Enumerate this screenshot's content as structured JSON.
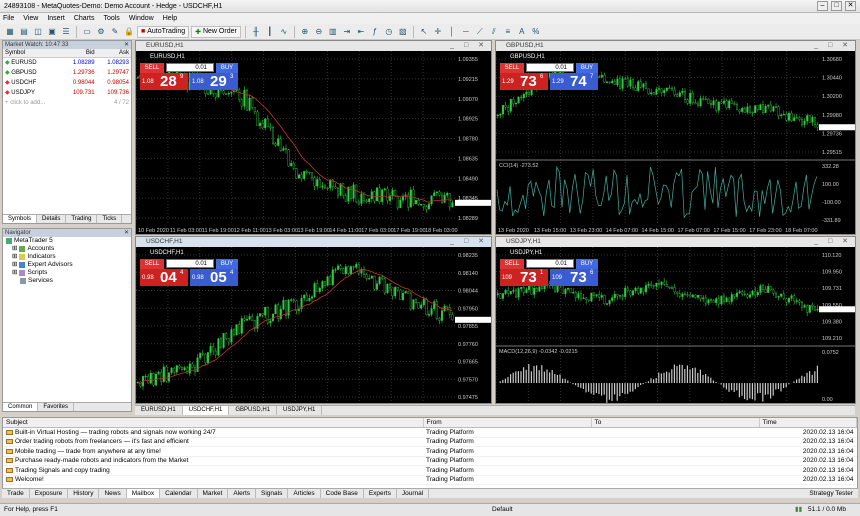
{
  "window": {
    "title": "24893108 - MetaQuotes-Demo: Demo Account - Hedge - USDCHF,H1",
    "min": "–",
    "max": "□",
    "close": "✕"
  },
  "menu": [
    "File",
    "View",
    "Insert",
    "Charts",
    "Tools",
    "Window",
    "Help"
  ],
  "toolbar": {
    "autotrading": "AutoTrading",
    "neworder": "New Order"
  },
  "market_watch": {
    "title": "Market Watch: 10:47:33",
    "cols": [
      "Symbol",
      "Bid",
      "Ask"
    ],
    "rows": [
      [
        "EURUSD",
        "1.08289",
        "1.08293"
      ],
      [
        "GBPUSD",
        "1.29736",
        "1.29747"
      ],
      [
        "USDCHF",
        "0.98044",
        "0.98054"
      ],
      [
        "USDJPY",
        "109.731",
        "109.736"
      ]
    ],
    "add": "click to add...",
    "count": "4 / 72",
    "tabs": [
      "Symbols",
      "Details",
      "Trading",
      "Ticks"
    ]
  },
  "navigator": {
    "title": "Navigator",
    "items": [
      "MetaTrader 5",
      "Accounts",
      "Indicators",
      "Expert Advisors",
      "Scripts",
      "Services"
    ],
    "tabs": [
      "Common",
      "Favorites"
    ]
  },
  "charts": [
    {
      "title": "EURUSD,H1",
      "sym": "EURUSD,H1",
      "lot": "0.01",
      "sell_small": "1.08",
      "sell_big": "28",
      "sell_sup": "9",
      "buy_small": "1.08",
      "buy_big": "29",
      "buy_sup": "3",
      "prices": [
        "1.09355",
        "1.09215",
        "1.09070",
        "1.08925",
        "1.08780",
        "1.08635",
        "1.08490",
        "1.08345",
        "1.08289"
      ],
      "times": [
        "10 Feb 2020",
        "11 Feb 03:00",
        "11 Feb 19:00",
        "12 Feb 11:00",
        "13 Feb 03:00",
        "13 Feb 19:00",
        "14 Feb 11:00",
        "17 Feb 03:00",
        "17 Feb 19:00",
        "18 Feb 03:00"
      ]
    },
    {
      "title": "GBPUSD,H1",
      "sym": "GBPUSD,H1",
      "lot": "0.01",
      "sell_small": "1.29",
      "sell_big": "73",
      "sell_sup": "6",
      "buy_small": "1.29",
      "buy_big": "74",
      "buy_sup": "7",
      "prices": [
        "1.30680",
        "1.30440",
        "1.30200",
        "1.29980",
        "1.29736",
        "1.29515"
      ],
      "ind": "CCI(14) -273.52",
      "ind_vals": [
        "332.28",
        "100.00",
        "-100.00",
        "-331.89"
      ],
      "times": [
        "13 Feb 2020",
        "13 Feb 15:00",
        "13 Feb 23:00",
        "14 Feb 07:00",
        "14 Feb 15:00",
        "17 Feb 07:00",
        "17 Feb 15:00",
        "17 Feb 23:00",
        "18 Feb 07:00"
      ]
    },
    {
      "title": "USDCHF,H1",
      "sym": "USDCHF,H1",
      "lot": "0.01",
      "sell_small": "0.98",
      "sell_big": "04",
      "sell_sup": "4",
      "buy_small": "0.98",
      "buy_big": "05",
      "buy_sup": "4",
      "prices": [
        "0.98235",
        "0.98140",
        "0.98044",
        "0.97950",
        "0.97855",
        "0.97760",
        "0.97665",
        "0.97570",
        "0.97475"
      ]
    },
    {
      "title": "USDJPY,H1",
      "sym": "USDJPY,H1",
      "lot": "0.01",
      "sell_small": "109",
      "sell_big": "73",
      "sell_sup": "1",
      "buy_small": "109",
      "buy_big": "73",
      "buy_sup": "6",
      "prices": [
        "110.120",
        "109.950",
        "109.731",
        "109.550",
        "109.380",
        "109.210"
      ],
      "ind": "MACD(12,26,9) -0.0342 -0.0215",
      "ind_vals": [
        "0.0752",
        "0.00"
      ]
    }
  ],
  "chart_tabs": [
    "EURUSD,H1",
    "USDCHF,H1",
    "GBPUSD,H1",
    "USDJPY,H1"
  ],
  "toolbox": {
    "cols": [
      "Subject",
      "From",
      "To",
      "Time"
    ],
    "rows": [
      [
        "Built-in Virtual Hosting — trading robots and signals now working 24/7",
        "Trading Platform",
        "",
        "2020.02.13 16:04"
      ],
      [
        "Order trading robots from freelancers — it's fast and efficient",
        "Trading Platform",
        "",
        "2020.02.13 16:04"
      ],
      [
        "Mobile trading — trade from anywhere at any time!",
        "Trading Platform",
        "",
        "2020.02.13 16:04"
      ],
      [
        "Purchase ready-made robots and indicators from the Market",
        "Trading Platform",
        "",
        "2020.02.13 16:04"
      ],
      [
        "Trading Signals and copy trading",
        "Trading Platform",
        "",
        "2020.02.13 16:04"
      ],
      [
        "Welcome!",
        "Trading Platform",
        "",
        "2020.02.13 16:04"
      ]
    ],
    "tabs": [
      "Trade",
      "Exposure",
      "History",
      "News",
      "Mailbox",
      "Calendar",
      "Market",
      "Alerts",
      "Signals",
      "Articles",
      "Code Base",
      "Experts",
      "Journal"
    ],
    "strategy": "Strategy Tester",
    "side": "Toolbox"
  },
  "status": {
    "help": "For Help, press F1",
    "profile": "Default",
    "conn": "51.1 / 0.0 Mb"
  }
}
